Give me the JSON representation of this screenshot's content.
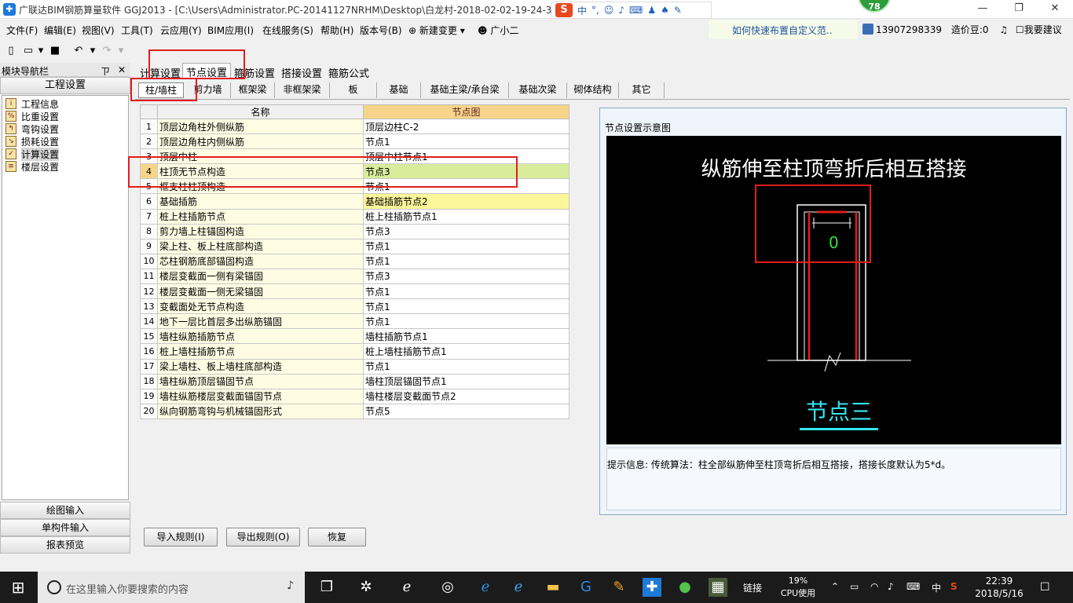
{
  "window": {
    "title": "广联达BIM钢筋算量软件 GGJ2013 - [C:\\Users\\Administrator.PC-20141127NRHM\\Desktop\\白龙村-2018-02-02-19-24-35",
    "minimize": "—",
    "maximize": "❐",
    "close": "✕",
    "badge": "78"
  },
  "ime": {
    "logo": "S",
    "lang": "中",
    "punct": "°,"
  },
  "menu": {
    "items": [
      "文件(F)",
      "编辑(E)",
      "视图(V)",
      "工具(T)",
      "云应用(Y)",
      "BIM应用(I)",
      "在线服务(S)",
      "帮助(H)",
      "版本号(B)",
      "新建变更",
      "广小二"
    ],
    "hint": "如何快速布置自定义范..",
    "user": "13907298339",
    "beans": "造价豆:0",
    "suggest": "我要建议"
  },
  "nav": {
    "header": "模块导航栏",
    "pin": "ㄗ",
    "close": "✕",
    "group": "工程设置",
    "items": [
      "工程信息",
      "比重设置",
      "弯钩设置",
      "损耗设置",
      "计算设置",
      "楼层设置"
    ],
    "bottom": [
      "绘图输入",
      "单构件输入",
      "报表预览"
    ]
  },
  "main_tabs": [
    "计算设置",
    "节点设置",
    "箍筋设置",
    "搭接设置",
    "箍筋公式"
  ],
  "sub_tabs": [
    "柱/墙柱",
    "剪力墙",
    "框架梁",
    "非框架梁",
    "板",
    "基础",
    "基础主梁/承台梁",
    "基础次梁",
    "砌体结构",
    "其它"
  ],
  "table": {
    "headers": [
      "名称",
      "节点图"
    ],
    "rows": [
      {
        "idx": "1",
        "name": "顶层边角柱外侧纵筋",
        "node": "顶层边柱C-2"
      },
      {
        "idx": "2",
        "name": "顶层边角柱内侧纵筋",
        "node": "节点1"
      },
      {
        "idx": "3",
        "name": "顶层中柱",
        "node": "顶层中柱节点1"
      },
      {
        "idx": "4",
        "name": "柱顶无节点构造",
        "node": "节点3"
      },
      {
        "idx": "5",
        "name": "框支柱柱顶构造",
        "node": "节点1"
      },
      {
        "idx": "6",
        "name": "基础插筋",
        "node": "基础插筋节点2"
      },
      {
        "idx": "7",
        "name": "桩上柱插筋节点",
        "node": "桩上柱插筋节点1"
      },
      {
        "idx": "8",
        "name": "剪力墙上柱锚固构造",
        "node": "节点3"
      },
      {
        "idx": "9",
        "name": "梁上柱、板上柱底部构造",
        "node": "节点1"
      },
      {
        "idx": "10",
        "name": "芯柱钢筋底部锚固构造",
        "node": "节点1"
      },
      {
        "idx": "11",
        "name": "楼层变截面一侧有梁锚固",
        "node": "节点3"
      },
      {
        "idx": "12",
        "name": "楼层变截面一侧无梁锚固",
        "node": "节点1"
      },
      {
        "idx": "13",
        "name": "变截面处无节点构造",
        "node": "节点1"
      },
      {
        "idx": "14",
        "name": "地下一层比首层多出纵筋锚固",
        "node": "节点1"
      },
      {
        "idx": "15",
        "name": "墙柱纵筋插筋节点",
        "node": "墙柱插筋节点1"
      },
      {
        "idx": "16",
        "name": "桩上墙柱插筋节点",
        "node": "桩上墙柱插筋节点1"
      },
      {
        "idx": "17",
        "name": "梁上墙柱、板上墙柱底部构造",
        "node": "节点1"
      },
      {
        "idx": "18",
        "name": "墙柱纵筋顶层锚固节点",
        "node": "墙柱顶层锚固节点1"
      },
      {
        "idx": "19",
        "name": "墙柱纵筋楼层变截面锚固节点",
        "node": "墙柱楼层变截面节点2"
      },
      {
        "idx": "20",
        "name": "纵向钢筋弯钩与机械锚固形式",
        "node": "节点5"
      }
    ]
  },
  "diagram": {
    "panel_title": "节点设置示意图",
    "title": "纵筋伸至柱顶弯折后相互搭接",
    "dimension": "0",
    "caption": "节点三",
    "hint": "提示信息:  传统算法：柱全部纵筋伸至柱顶弯折后相互搭接，搭接长度默认为5*d。"
  },
  "buttons": {
    "import": "导入规则(I)",
    "export": "导出规则(O)",
    "restore": "恢复"
  },
  "taskbar": {
    "search_placeholder": "在这里输入你要搜索的内容",
    "link": "链接",
    "cpu_pct": "19%",
    "cpu_label": "CPU使用",
    "lang": "中",
    "time": "22:39",
    "date": "2018/5/16"
  },
  "colors": {
    "highlight_red": "#e21d1d",
    "node_header": "#f6d58a",
    "selected_node": "#d9ec9c",
    "diagram_bg": "#000000",
    "caption": "#34e6f2"
  }
}
